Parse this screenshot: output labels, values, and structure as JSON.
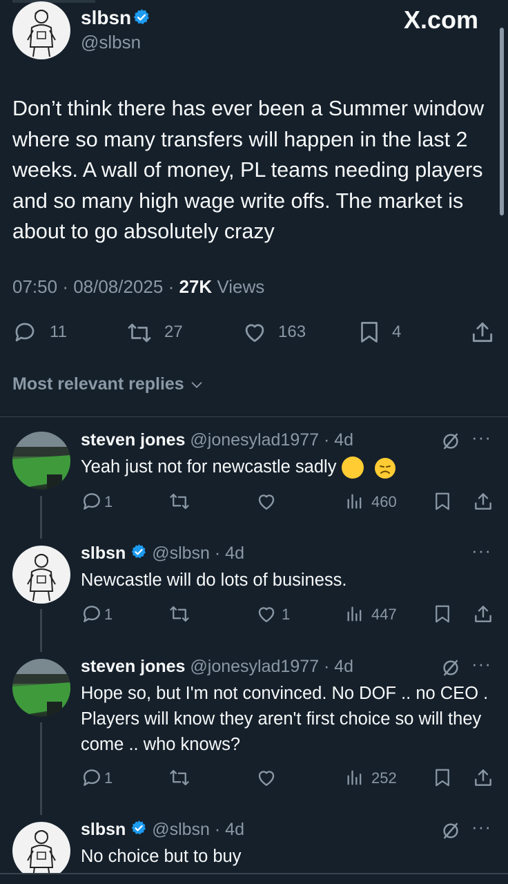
{
  "header": {
    "site_logo": "X.com"
  },
  "main_tweet": {
    "author_name": "slbsn",
    "author_handle": "@slbsn",
    "text": "Don’t think there has ever been a Summer window where so many transfers will happen in the last 2 weeks. A wall of money, PL teams needing players and so many high wage write offs. The market is about to go absolutely crazy",
    "time": "07:50",
    "date": "08/08/2025",
    "views_count": "27K",
    "views_label": "Views",
    "replies": "11",
    "reposts": "27",
    "likes": "163",
    "bookmarks": "4"
  },
  "replies_filter": {
    "label": "Most relevant replies"
  },
  "replies": [
    {
      "name": "steven jones",
      "handle": "@jonesylad1977",
      "age": "4d",
      "text": "Yeah just not for newcastle sadly",
      "emoji": "😞",
      "reply_count": "1",
      "like_count": "",
      "views": "460"
    },
    {
      "name": "slbsn",
      "handle": "@slbsn",
      "age": "4d",
      "text": "Newcastle will do lots of business.",
      "reply_count": "1",
      "like_count": "1",
      "views": "447"
    },
    {
      "name": "steven jones",
      "handle": "@jonesylad1977",
      "age": "4d",
      "text": "Hope so, but I'm not convinced.  No DOF .. no CEO . Players will know they aren't first choice so will they come .. who knows?",
      "reply_count": "1",
      "like_count": "",
      "views": "252"
    },
    {
      "name": "slbsn",
      "handle": "@slbsn",
      "age": "4d",
      "text": "No choice but to buy"
    }
  ],
  "icons": {
    "verified": "verified-badge-icon",
    "reply": "speech-bubble-icon",
    "repost": "repost-arrows-icon",
    "like": "heart-icon",
    "bookmark": "bookmark-icon",
    "share": "share-upload-icon",
    "views": "bar-chart-icon",
    "grok": "slashed-circle-icon",
    "more": "more-dots-icon"
  },
  "colors": {
    "background": "#15202b",
    "verified": "#1d9bf0",
    "muted": "#8b98a5",
    "text": "#f7f9f9"
  }
}
